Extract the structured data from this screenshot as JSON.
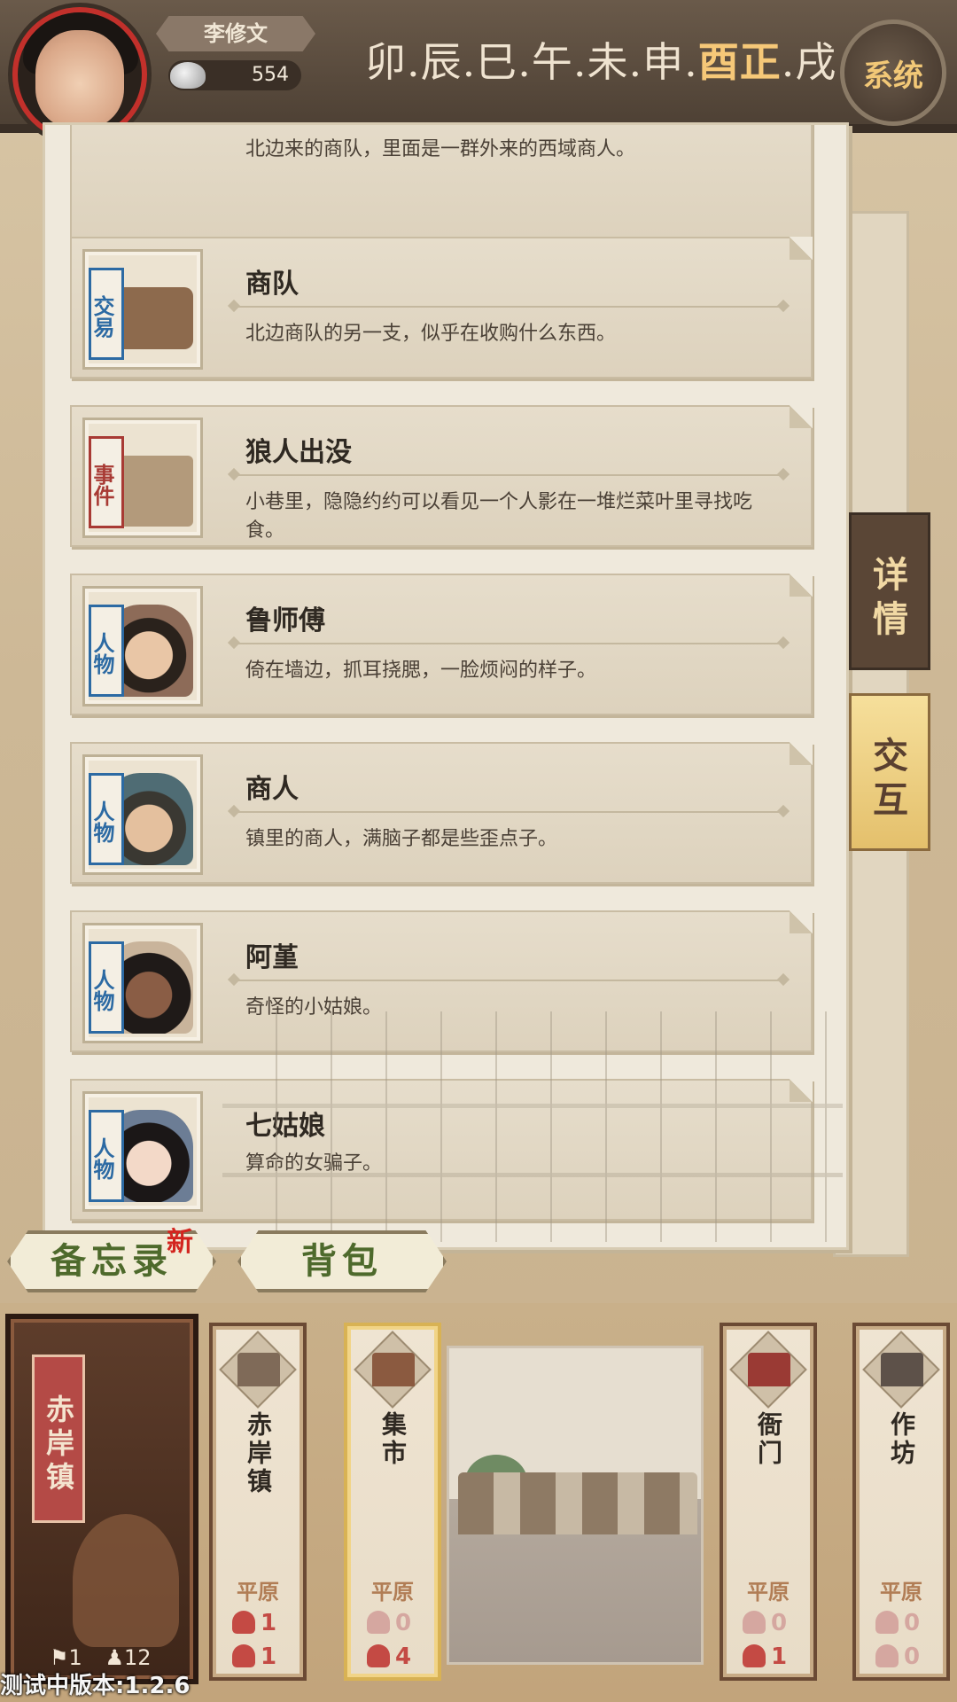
{
  "player": {
    "name": "李修文",
    "money": "554"
  },
  "timeline": {
    "before": "卯.辰.巳.午.未.申.",
    "current": "酉正",
    "after": ".戌"
  },
  "system_button": "系统",
  "list": {
    "partial_top_text": "北边来的商队，里面是一群外来的西域商人。",
    "items": [
      {
        "tag": "交易",
        "title": "商队",
        "desc": "北边商队的另一支，似乎在收购什么东西。",
        "tag_color": "blue"
      },
      {
        "tag": "事件",
        "title": "狼人出没",
        "desc": "小巷里，隐隐约约可以看见一个人影在一堆烂菜叶里寻找吃食。",
        "tag_color": "red"
      },
      {
        "tag": "人物",
        "title": "鲁师傅",
        "desc": "倚在墙边，抓耳挠腮，一脸烦闷的样子。",
        "tag_color": "blue"
      },
      {
        "tag": "人物",
        "title": "商人",
        "desc": "镇里的商人，满脑子都是些歪点子。",
        "tag_color": "blue"
      },
      {
        "tag": "人物",
        "title": "阿堇",
        "desc": "奇怪的小姑娘。",
        "tag_color": "blue"
      },
      {
        "tag": "人物",
        "title": "七姑娘",
        "desc": "算命的女骗子。",
        "tag_color": "blue"
      }
    ]
  },
  "side_tabs": {
    "detail": "详情",
    "interact": "交互"
  },
  "buttons": {
    "memo": "备忘录",
    "new_badge": "新",
    "bag": "背包"
  },
  "current_town": {
    "name": "赤岸镇",
    "quests": "1",
    "people": "12"
  },
  "locations": [
    {
      "name": "赤岸镇",
      "terrain": "平原",
      "quests": "1",
      "people": "1"
    },
    {
      "name": "集市",
      "terrain": "平原",
      "quests": "0",
      "people": "4"
    },
    {
      "name": "衙门",
      "terrain": "平原",
      "quests": "0",
      "people": "1"
    },
    {
      "name": "作坊",
      "terrain": "平原",
      "quests": "0",
      "people": "0"
    }
  ],
  "version": "测试中版本:1.2.6",
  "colors": {
    "tag_blue": "#2c6aa3",
    "tag_red": "#a83a34",
    "time_current": "#f6c878",
    "accent_red": "#c44a44"
  }
}
